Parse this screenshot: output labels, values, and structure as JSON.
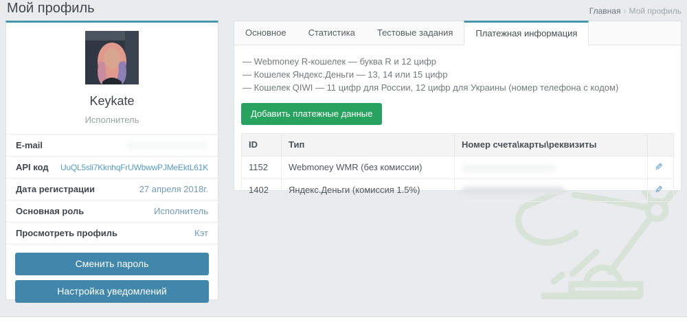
{
  "page": {
    "title": "Мой профиль",
    "breadcrumb": {
      "home": "Главная",
      "separator": "›",
      "current": "Мой профиль"
    }
  },
  "profile_card": {
    "name": "Keykate",
    "role": "Исполнитель",
    "fields": {
      "email": {
        "label": "E-mail",
        "value": ""
      },
      "api": {
        "label": "API код",
        "value": "UuQL5sli7KknhqFrUWbwwPJMeEktL61K"
      },
      "reg_date": {
        "label": "Дата регистрации",
        "value": "27 апреля 2018г."
      },
      "main_role": {
        "label": "Основная роль",
        "value": "Исполнитель"
      },
      "view": {
        "label": "Просмотреть профиль",
        "value": "Кэт"
      }
    },
    "buttons": {
      "change_password": "Сменить пароль",
      "notifications": "Настройка уведомлений"
    }
  },
  "panel": {
    "tabs": [
      {
        "label": "Основное",
        "active": false
      },
      {
        "label": "Статистика",
        "active": false
      },
      {
        "label": "Тестовые задания",
        "active": false
      },
      {
        "label": "Платежная информация",
        "active": true
      }
    ],
    "notes": [
      "— Webmoney R-кошелек — буква R и 12 цифр",
      "— Кошелек Яндекс.Деньги — 13, 14 или 15 цифр",
      "— Кошелек QIWI — 11 цифр для России, 12 цифр для Украины (номер телефона с кодом)"
    ],
    "add_button": "Добавить платежные данные",
    "table": {
      "headers": [
        "ID",
        "Тип",
        "Номер счета\\карты\\реквизиты",
        ""
      ],
      "rows": [
        {
          "id": "1152",
          "type": "Webmoney WMR (без комиссии)",
          "number": ""
        },
        {
          "id": "1402",
          "type": "Яндекс.Деньги (комиссия 1.5%)",
          "number": ""
        }
      ],
      "edit_icon": "✎"
    }
  },
  "colors": {
    "accent_teal": "#4696ac",
    "button_blue": "#4187ac",
    "button_green": "#27a35f",
    "link_blue": "#549bc8",
    "value_blue": "#6f9aba",
    "lamp_green": "#d8e3d7",
    "background": "#e9ebee"
  }
}
